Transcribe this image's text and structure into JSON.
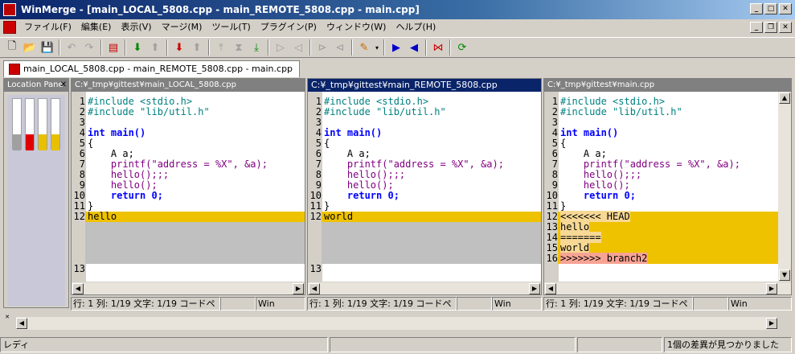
{
  "window": {
    "title": "WinMerge - [main_LOCAL_5808.cpp - main_REMOTE_5808.cpp - main.cpp]",
    "min": "_",
    "max": "□",
    "close": "✕"
  },
  "menu": [
    "ファイル(F)",
    "編集(E)",
    "表示(V)",
    "マージ(M)",
    "ツール(T)",
    "プラグイン(P)",
    "ウィンドウ(W)",
    "ヘルプ(H)"
  ],
  "mdi": {
    "min": "_",
    "restore": "❐",
    "close": "✕"
  },
  "tab": {
    "label": "main_LOCAL_5808.cpp - main_REMOTE_5808.cpp - main.cpp"
  },
  "location_pane": {
    "title": "Location Pane",
    "close": "✕"
  },
  "panes": [
    {
      "path": "C:¥_tmp¥gittest¥main_LOCAL_5808.cpp",
      "lines": [
        {
          "n": "1",
          "t": "#include <stdio.h>"
        },
        {
          "n": "2",
          "t": "#include \"lib/util.h\""
        },
        {
          "n": "3",
          "t": ""
        },
        {
          "n": "4",
          "t": "int main()"
        },
        {
          "n": "5",
          "t": "{"
        },
        {
          "n": "6",
          "t": "    A a;"
        },
        {
          "n": "7",
          "t": "    printf(\"address = %X\", &a);"
        },
        {
          "n": "8",
          "t": "    hello();;;"
        },
        {
          "n": "9",
          "t": "    hello();"
        },
        {
          "n": "10",
          "t": "    return 0;"
        },
        {
          "n": "11",
          "t": "}"
        },
        {
          "n": "12",
          "t": "hello"
        },
        {
          "n": "13",
          "t": ""
        }
      ]
    },
    {
      "path": "C:¥_tmp¥gittest¥main_REMOTE_5808.cpp",
      "lines": [
        {
          "n": "1",
          "t": "#include <stdio.h>"
        },
        {
          "n": "2",
          "t": "#include \"lib/util.h\""
        },
        {
          "n": "3",
          "t": ""
        },
        {
          "n": "4",
          "t": "int main()"
        },
        {
          "n": "5",
          "t": "{"
        },
        {
          "n": "6",
          "t": "    A a;"
        },
        {
          "n": "7",
          "t": "    printf(\"address = %X\", &a);"
        },
        {
          "n": "8",
          "t": "    hello();;;"
        },
        {
          "n": "9",
          "t": "    hello();"
        },
        {
          "n": "10",
          "t": "    return 0;"
        },
        {
          "n": "11",
          "t": "}"
        },
        {
          "n": "12",
          "t": "world"
        },
        {
          "n": "13",
          "t": ""
        }
      ]
    },
    {
      "path": "C:¥_tmp¥gittest¥main.cpp",
      "lines": [
        {
          "n": "1",
          "t": "#include <stdio.h>"
        },
        {
          "n": "2",
          "t": "#include \"lib/util.h\""
        },
        {
          "n": "3",
          "t": ""
        },
        {
          "n": "4",
          "t": "int main()"
        },
        {
          "n": "5",
          "t": "{"
        },
        {
          "n": "6",
          "t": "    A a;"
        },
        {
          "n": "7",
          "t": "    printf(\"address = %X\", &a);"
        },
        {
          "n": "8",
          "t": "    hello();;;"
        },
        {
          "n": "9",
          "t": "    hello();"
        },
        {
          "n": "10",
          "t": "    return 0;"
        },
        {
          "n": "11",
          "t": "}"
        },
        {
          "n": "12",
          "t": "<<<<<<< HEAD"
        },
        {
          "n": "13",
          "t": "hello"
        },
        {
          "n": "14",
          "t": "======="
        },
        {
          "n": "15",
          "t": "world"
        },
        {
          "n": "16",
          "t": ">>>>>>> branch2"
        }
      ]
    }
  ],
  "pane_status": {
    "position": "行: 1  列: 1/19  文字: 1/19  コードペ",
    "eol": "Win"
  },
  "statusbar": {
    "ready": "レディ",
    "diffs": "1個の差異が見つかりました"
  },
  "colors": {
    "diff": "#efc200",
    "conflict_head": "#f7d894",
    "conflict_marker": "#f7a394",
    "active_header": "#0a246a"
  }
}
